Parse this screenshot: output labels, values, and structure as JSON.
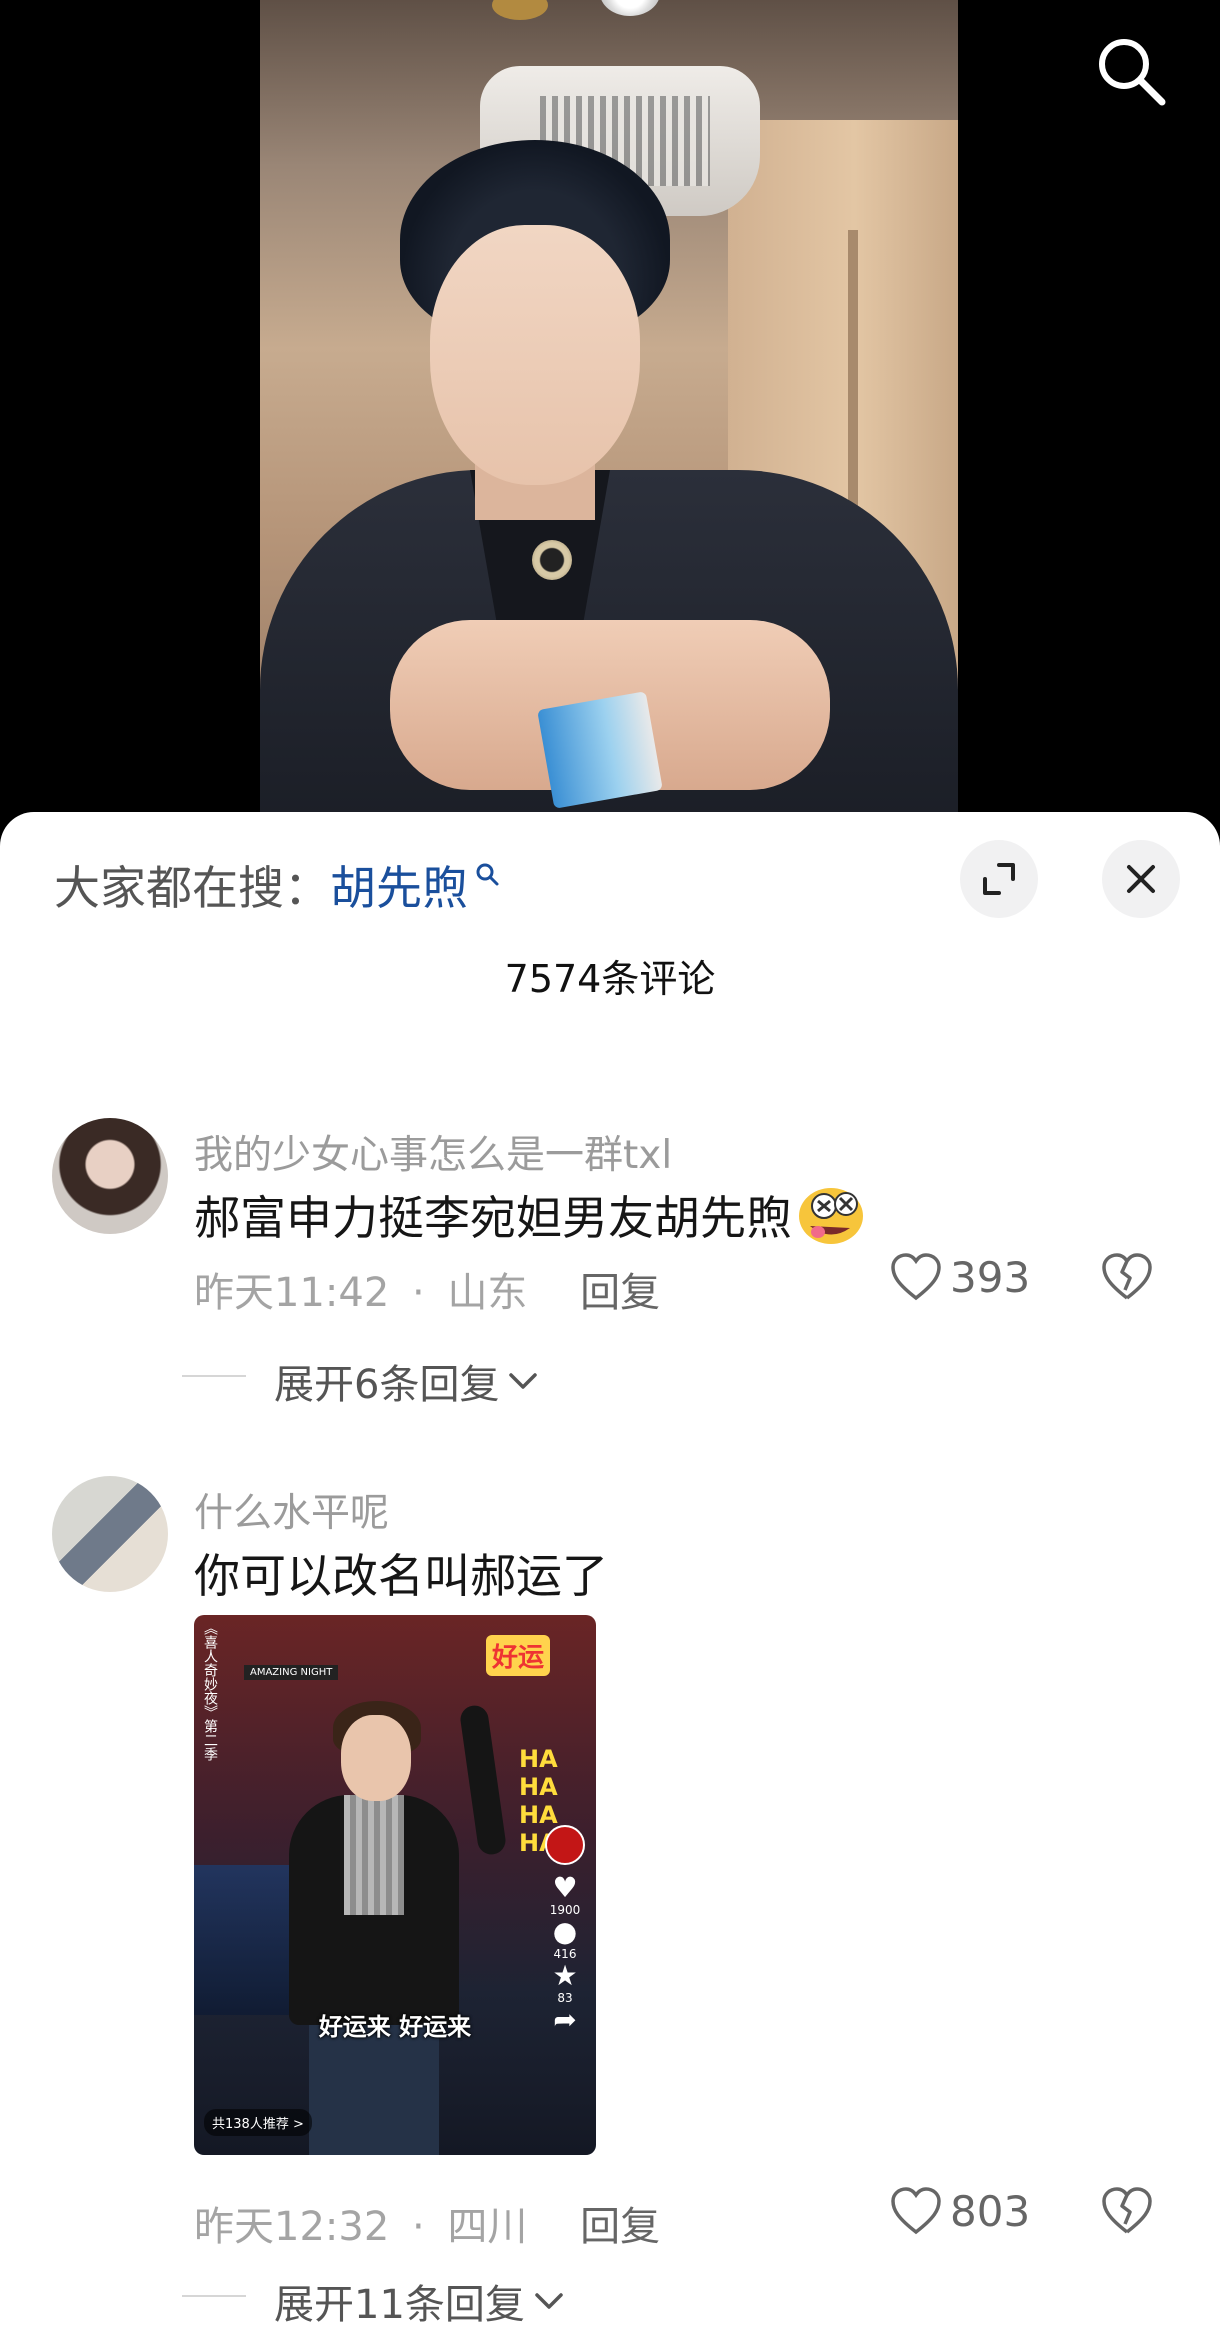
{
  "video": {
    "search_icon": "search-icon"
  },
  "sheet": {
    "search_hint_prefix": "大家都在搜：",
    "search_hint_keyword": "胡先煦",
    "expand_icon": "fullscreen-icon",
    "close_icon": "close-icon",
    "comment_count_title": "7574条评论"
  },
  "comments": [
    {
      "username": "我的少女心事怎么是一群txl",
      "text": "郝富申力挺李宛妲男友胡先煦",
      "emoji": "drooling-face-emoji",
      "time": "昨天11:42",
      "location": "山东",
      "separator": "·",
      "reply_label": "回复",
      "likes": "393",
      "expand_label": "展开6条回复"
    },
    {
      "username": "什么水平呢",
      "text": "你可以改名叫郝运了",
      "time": "昨天12:32",
      "location": "四川",
      "separator": "·",
      "reply_label": "回复",
      "likes": "803",
      "expand_label": "展开11条回复",
      "image": {
        "sticker_text": "好运",
        "caption": "好运来 好运来",
        "vertical_title": "《喜人奇妙夜》第二季",
        "sign_text": "AMAZING NIGHT",
        "ha_text": "HA HA HA HA",
        "like_count": "1900",
        "comment_count": "416",
        "fav_count": "83",
        "badge_text": "共138人推荐 >"
      }
    }
  ],
  "colors": {
    "keyword_blue": "#1a4f9c",
    "meta_gray": "#a4a4a4",
    "text_dark": "#161616"
  }
}
